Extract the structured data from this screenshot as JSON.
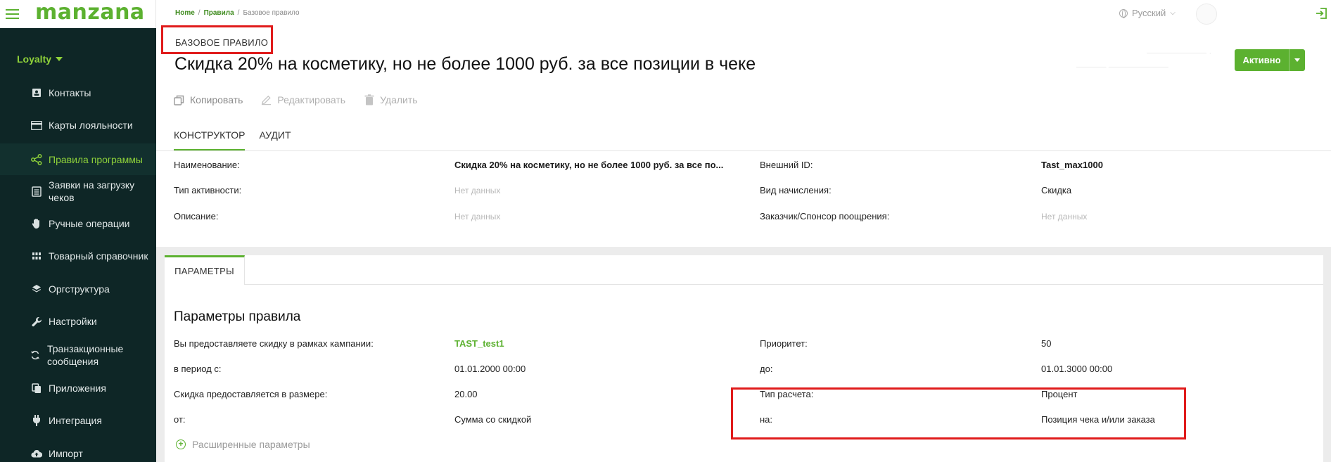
{
  "brand": {
    "logo": "manzana",
    "accent": "#5cb130",
    "sidebar_bg": "#0e2626"
  },
  "sidebar": {
    "group": "Loyalty",
    "items": [
      {
        "label": "Контакты",
        "icon": "contact-card-icon"
      },
      {
        "label": "Карты лояльности",
        "icon": "credit-card-icon"
      },
      {
        "label": "Правила программы",
        "icon": "share-nodes-icon"
      },
      {
        "label": "Заявки на загрузку",
        "label2": "чеков",
        "icon": "receipt-icon"
      },
      {
        "label": "Ручные операции",
        "icon": "hand-icon"
      },
      {
        "label": "Товарный справочник",
        "icon": "grid-icon"
      },
      {
        "label": "Оргструктура",
        "icon": "layers-icon"
      },
      {
        "label": "Настройки",
        "icon": "wrench-icon"
      },
      {
        "label": "Транзакционные",
        "label2": "сообщения",
        "icon": "refresh-icon"
      },
      {
        "label": "Приложения",
        "icon": "copy-icon"
      },
      {
        "label": "Интеграция",
        "icon": "plug-icon"
      },
      {
        "label": "Импорт",
        "icon": "cloud-upload-icon"
      }
    ]
  },
  "breadcrumb": {
    "home": "Home",
    "rules": "Правила",
    "current": "Базовое правило"
  },
  "topbar": {
    "language": "Русский"
  },
  "header": {
    "kind": "БАЗОВОЕ ПРАВИЛО",
    "title": "Скидка 20% на косметику, но не более 1000 руб. за все позиции в чеке",
    "status": "Активно"
  },
  "toolbar": {
    "copy": "Копировать",
    "edit": "Редактировать",
    "delete": "Удалить"
  },
  "tabs": {
    "constructor": "КОНСТРУКТОР",
    "audit": "АУДИТ"
  },
  "info": {
    "name_label": "Наименование:",
    "name_value": "Скидка 20% на косметику, но не более 1000 руб. за все по...",
    "activity_label": "Тип активности:",
    "activity_value": "Нет данных",
    "description_label": "Описание:",
    "description_value": "Нет данных",
    "external_id_label": "Внешний ID:",
    "external_id_value": "Tast_max1000",
    "accrual_label": "Вид начисления:",
    "accrual_value": "Скидка",
    "sponsor_label": "Заказчик/Спонсор поощрения:",
    "sponsor_value": "Нет данных"
  },
  "params_tab": "ПАРАМЕТРЫ",
  "params": {
    "title": "Параметры правила",
    "campaign_label": "Вы предоставляете скидку в рамках кампании:",
    "campaign_value": "TAST_test1",
    "priority_label": "Приоритет:",
    "priority_value": "50",
    "period_from_label": "в период с:",
    "period_from_value": "01.01.2000 00:00",
    "period_to_label": "до:",
    "period_to_value": "01.01.3000 00:00",
    "amount_label": "Скидка предоставляется в размере:",
    "amount_value": "20.00",
    "calc_type_label": "Тип расчета:",
    "calc_type_value": "Процент",
    "from_label": "от:",
    "from_value": "Сумма со скидкой",
    "on_label": "на:",
    "on_value": "Позиция чека и/или заказа",
    "advanced": "Расширенные параметры"
  }
}
